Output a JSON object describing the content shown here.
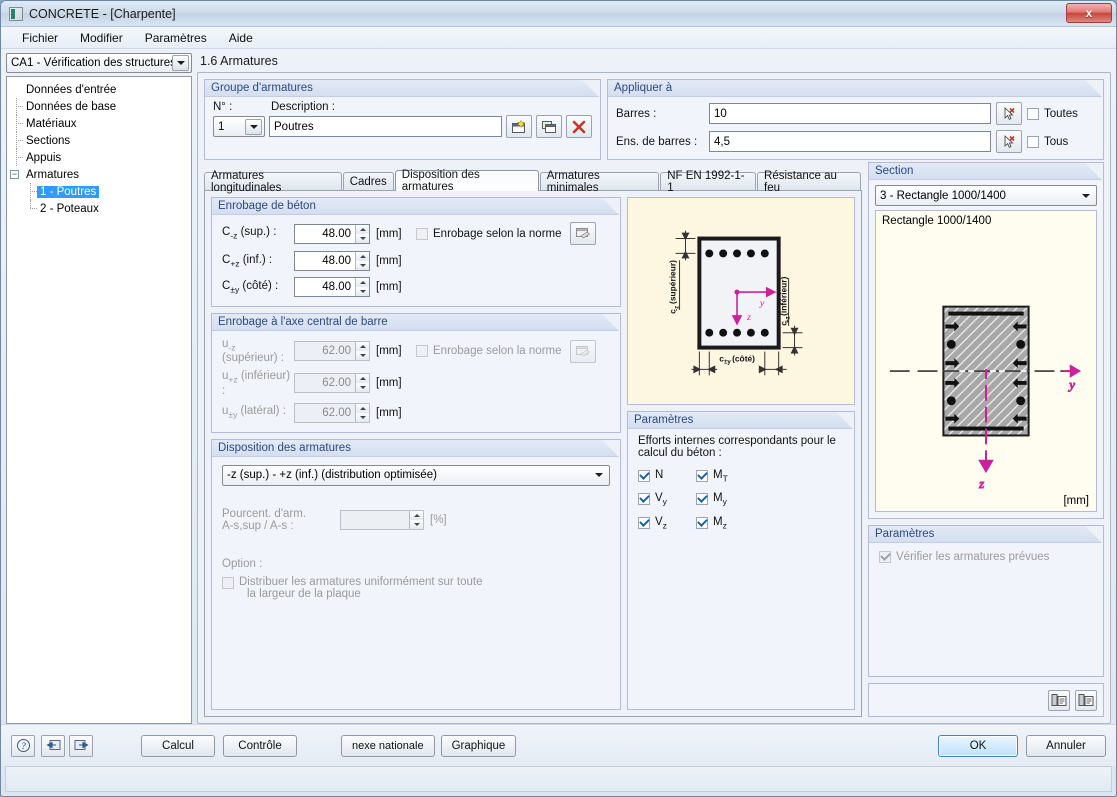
{
  "window": {
    "title": "CONCRETE - [Charpente]",
    "close_label": "x"
  },
  "menu": [
    "Fichier",
    "Modifier",
    "Paramètres",
    "Aide"
  ],
  "sidebar": {
    "case_selector": "CA1 - Vérification des structures",
    "tree": {
      "root": "Données d'entrée",
      "items": [
        "Données de base",
        "Matériaux",
        "Sections",
        "Appuis"
      ],
      "group": "Armatures",
      "children": [
        "1 - Poutres",
        "2 - Poteaux"
      ],
      "selected": "1 - Poutres"
    }
  },
  "page": {
    "title": "1.6 Armatures"
  },
  "reinforcement_group": {
    "legend": "Groupe d'armatures",
    "no_label": "N° :",
    "no_value": "1",
    "description_label": "Description :",
    "description_value": "Poutres",
    "new_btn": "new-group",
    "copy_btn": "copy-group",
    "delete_btn": "delete-group"
  },
  "apply_to": {
    "legend": "Appliquer à",
    "bars_label": "Barres :",
    "bars_value": "10",
    "sets_label": "Ens. de barres :",
    "sets_value": "4,5",
    "all_bars_label": "Toutes",
    "all_sets_label": "Tous",
    "all_bars_checked": false,
    "all_sets_checked": false
  },
  "tabs": [
    {
      "label": "Armatures longitudinales",
      "active": false
    },
    {
      "label": "Cadres",
      "active": false
    },
    {
      "label": "Disposition des armatures",
      "active": true
    },
    {
      "label": "Armatures minimales",
      "active": false
    },
    {
      "label": "NF EN 1992-1-1",
      "active": false
    },
    {
      "label": "Résistance au feu",
      "active": false
    }
  ],
  "concrete_cover": {
    "legend": "Enrobage de béton",
    "unit": "[mm]",
    "standard_label": "Enrobage selon la norme",
    "standard_checked": false,
    "rows": [
      {
        "label_main": "C",
        "label_sub": "-z",
        "label_rest": " (sup.) :",
        "value": "48.00"
      },
      {
        "label_main": "C",
        "label_sub": "+z",
        "label_rest": " (inf.) :",
        "value": "48.00"
      },
      {
        "label_main": "C",
        "label_sub": "±y",
        "label_rest": " (côté) :",
        "value": "48.00"
      }
    ]
  },
  "axis_cover": {
    "legend": "Enrobage à l'axe central de barre",
    "unit": "[mm]",
    "standard_label": "Enrobage selon la norme",
    "standard_checked": false,
    "rows": [
      {
        "label_main": "u",
        "label_sub": "-z",
        "label_rest": " (supérieur) :",
        "value": "62.00"
      },
      {
        "label_main": "u",
        "label_sub": "+z",
        "label_rest": " (inférieur) :",
        "value": "62.00"
      },
      {
        "label_main": "u",
        "label_sub": "±y",
        "label_rest": " (latéral) :",
        "value": "62.00"
      }
    ]
  },
  "layout": {
    "legend": "Disposition des armatures",
    "selected": "-z (sup.) - +z (inf.) (distribution optimisée)",
    "percent_label_line1": "Pourcent. d'arm.",
    "percent_label_line2": "A-s,sup / A-s :",
    "percent_value": "",
    "percent_unit": "[%]",
    "option_label": "Option :",
    "option_checkbox_line1": "Distribuer les armatures uniformément sur toute",
    "option_checkbox_line2": "la largeur de la plaque",
    "option_checked": false
  },
  "cover_diagram": {
    "label_top": "c-z (supérieur)",
    "label_bottom": "c+z (inférieur)",
    "label_side": "c±y (côté)",
    "axis_y": "y",
    "axis_z": "z",
    "axis_color": "#cc2299"
  },
  "parameters": {
    "legend": "Paramètres",
    "description_line1": "Efforts internes correspondants pour le",
    "description_line2": "calcul du béton :",
    "checkboxes": [
      {
        "label_main": "N",
        "label_sub": "",
        "checked": true
      },
      {
        "label_main": "M",
        "label_sub": "T",
        "checked": true
      },
      {
        "label_main": "V",
        "label_sub": "y",
        "checked": true
      },
      {
        "label_main": "M",
        "label_sub": "y",
        "checked": true
      },
      {
        "label_main": "V",
        "label_sub": "z",
        "checked": true
      },
      {
        "label_main": "M",
        "label_sub": "z",
        "checked": true
      }
    ]
  },
  "section": {
    "legend": "Section",
    "selected": "3 - Rectangle 1000/1400",
    "caption": "Rectangle 1000/1400",
    "unit": "[mm]",
    "axis_y": "y",
    "axis_z": "z",
    "axis_color": "#cc2299"
  },
  "section_parameters": {
    "legend": "Paramètres",
    "check_label": "Vérifier les armatures prévues",
    "checked": true
  },
  "bottom_buttons": {
    "help": "help-icon",
    "prev": "prev-icon",
    "next": "next-icon",
    "calcul": "Calcul",
    "controle": "Contrôle",
    "annexe": "nexe nationale",
    "graphique": "Graphique",
    "ok": "OK",
    "annuler": "Annuler"
  }
}
